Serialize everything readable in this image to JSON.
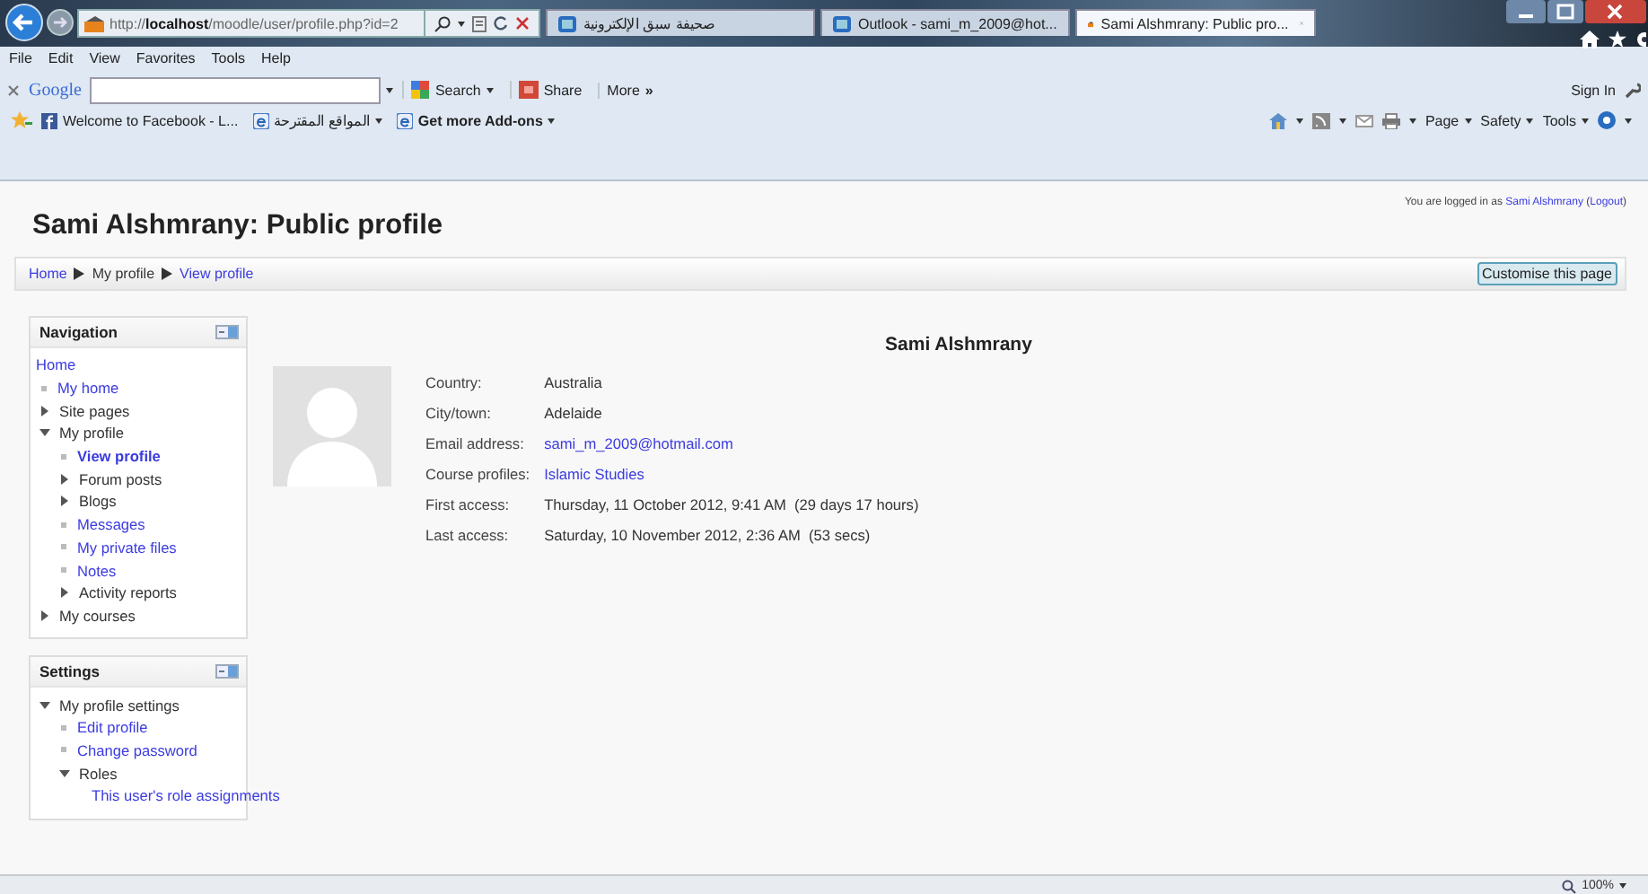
{
  "browser": {
    "tabs": [
      {
        "title": "صحيفة سبق الإلكترونية",
        "selected": false
      },
      {
        "title": "Outlook - sami_m_2009@hot...",
        "selected": false
      },
      {
        "title": "Sami Alshmrany: Public pro...",
        "selected": true
      }
    ],
    "address": "http://**localhost**/moodle/user/profile.php?id=2",
    "menu": [
      "File",
      "Edit",
      "View",
      "Favorites",
      "Tools",
      "Help"
    ],
    "google_toolbar": {
      "logo": "Google",
      "search_button": "Search",
      "share_button": "Share",
      "more_button": "More **»**",
      "sign_in": "Sign In"
    },
    "favorites": [
      {
        "label": "Welcome to Facebook - L...",
        "dropdown": false
      },
      {
        "label": "المواقع المقترحة",
        "dropdown": true
      },
      {
        "label": "Get more Add-ons",
        "dropdown": true
      }
    ],
    "command_bar": [
      "Page",
      "Safety",
      "Tools"
    ],
    "zoom": "100%"
  },
  "page": {
    "title": "Sami Alshmrany: Public profile",
    "login": [
      {
        "text": "You are logged in as "
      },
      {
        "link": "Sami Alshmrany"
      },
      {
        "text": " ("
      },
      {
        "link": "Logout"
      },
      {
        "text": ")"
      }
    ],
    "breadcrumb": [
      {
        "label": "Home",
        "link": true
      },
      {
        "label": "My profile",
        "link": false
      },
      {
        "label": "View profile",
        "link": true
      }
    ],
    "customise_button": "Customise this page",
    "blocks": [
      {
        "title": "Navigation",
        "items": [
          {
            "label": "Home",
            "kind": "root"
          },
          {
            "label": "My home",
            "kind": "leaf",
            "selected": false
          },
          {
            "label": "Site pages",
            "kind": "branch",
            "expanded": false
          },
          {
            "label": "My profile",
            "kind": "branch",
            "expanded": true,
            "children": [
              {
                "label": "View profile",
                "kind": "leaf",
                "selected": true
              },
              {
                "label": "Forum posts",
                "kind": "branch",
                "expanded": false
              },
              {
                "label": "Blogs",
                "kind": "branch",
                "expanded": false
              },
              {
                "label": "Messages",
                "kind": "leaf",
                "selected": false
              },
              {
                "label": "My private files",
                "kind": "leaf",
                "selected": false
              },
              {
                "label": "Notes",
                "kind": "leaf",
                "selected": false
              },
              {
                "label": "Activity reports",
                "kind": "branch",
                "expanded": false
              }
            ]
          },
          {
            "label": "My courses",
            "kind": "branch",
            "expanded": false
          }
        ]
      },
      {
        "title": "Settings",
        "items": [
          {
            "label": "My profile settings",
            "kind": "branch",
            "expanded": true,
            "children": [
              {
                "label": "Edit profile",
                "kind": "leaf",
                "selected": false
              },
              {
                "label": "Change password",
                "kind": "leaf",
                "selected": false
              },
              {
                "label": "Roles",
                "kind": "branch",
                "expanded": true,
                "children": [
                  {
                    "label": "This user's role assignments",
                    "kind": "leaf",
                    "selected": false
                  }
                ]
              }
            ]
          }
        ]
      }
    ],
    "profile": {
      "name": "Sami Alshmrany",
      "fields": [
        {
          "label": "Country:",
          "value": "Australia",
          "link": false
        },
        {
          "label": "City/town:",
          "value": "Adelaide",
          "link": false
        },
        {
          "label": "Email address:",
          "value": "sami_m_2009@hotmail.com",
          "link": true
        },
        {
          "label": "Course profiles:",
          "value": "Islamic Studies",
          "link": true
        },
        {
          "label": "First access:",
          "value": "Thursday, 11 October 2012, 9:41 AM  (29 days 17 hours)",
          "link": false
        },
        {
          "label": "Last access:",
          "value": "Saturday, 10 November 2012, 2:36 AM  (53 secs)",
          "link": false
        }
      ]
    }
  }
}
